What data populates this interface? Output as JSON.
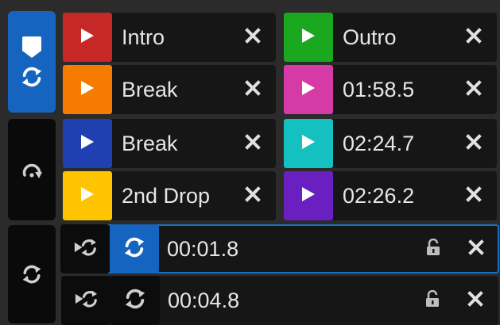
{
  "hotcues": [
    {
      "label": "Intro",
      "color": "#c62828"
    },
    {
      "label": "Outro",
      "color": "#19a81f"
    },
    {
      "label": "Break",
      "color": "#f57c00"
    },
    {
      "label": "01:58.5",
      "color": "#d63aa6"
    },
    {
      "label": "Break",
      "color": "#1e40b0"
    },
    {
      "label": "02:24.7",
      "color": "#14c0c0"
    },
    {
      "label": "2nd Drop",
      "color": "#ffc400"
    },
    {
      "label": "02:26.2",
      "color": "#6a1fc0"
    }
  ],
  "loops": [
    {
      "time": "00:01.8",
      "active": true
    },
    {
      "time": "00:04.8",
      "active": false
    }
  ],
  "colors": {
    "accent": "#1565c0",
    "background": "#2b2b2b",
    "cell": "#161616"
  },
  "icons": {
    "cue_mode": "cue-tag-icon",
    "cue_loop": "loop-arrows-icon",
    "saved_loop_mode": "loop-roll-icon",
    "loops_mode": "loop-arrows-icon",
    "delete": "close-x-icon",
    "lock": "padlock-icon",
    "jump": "loop-jump-icon"
  }
}
